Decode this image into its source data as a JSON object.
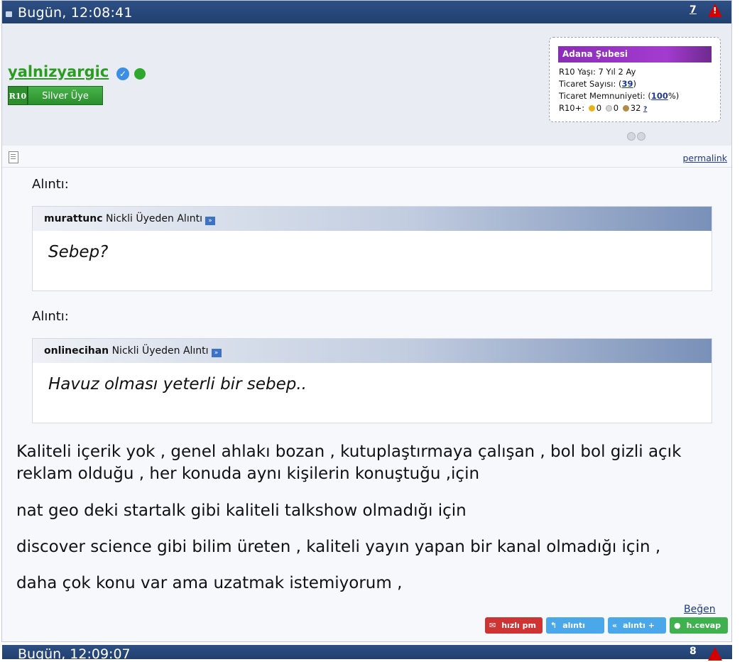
{
  "post": {
    "date": "Bugün, 12:08:41",
    "number": "7",
    "warn_glyph": "!"
  },
  "user": {
    "name": "yalnizyargic",
    "verified_glyph": "✓",
    "rank_code": "R10",
    "rank_title": "Silver Üye",
    "branch": "Adana Şubesi",
    "age_label": "R10 Yaşı: 7 Yıl 2 Ay",
    "trade_count_label": "Ticaret Sayısı: (",
    "trade_count": "39",
    "trade_count_suffix": ")",
    "satisfaction_label": "Ticaret Memnuniyeti: (",
    "satisfaction": "100",
    "satisfaction_suffix": "%)",
    "r10plus_label": "R10+:",
    "gold_count": "0",
    "silver_count": "0",
    "bronze_count": "32",
    "help_mark": "?"
  },
  "permalink_label": "permalink",
  "quotes": [
    {
      "label": "Alıntı:",
      "author": "murattunc",
      "source_text": "Nickli Üyeden Alıntı",
      "body": "Sebep?"
    },
    {
      "label": "Alıntı:",
      "author": "onlinecihan",
      "source_text": "Nickli Üyeden Alıntı",
      "body": "Havuz olması yeterli bir sebep.."
    }
  ],
  "message": [
    "Kaliteli içerik yok , genel ahlakı bozan , kutuplaştırmaya çalışan , bol bol gizli açık reklam olduğu , her konuda aynı kişilerin konuştuğu ,için",
    "nat geo deki startalk gibi kaliteli talkshow olmadığı için",
    "discover science gibi bilim üreten , kaliteli yayın yapan bir kanal olmadığı için ,",
    "daha çok konu var ama uzatmak istemiyorum ,"
  ],
  "actions": {
    "like": "Beğen",
    "quick_pm": "hızlı pm",
    "quote": "alıntı",
    "quote_plus": "alıntı +",
    "quick_reply": "h.cevap"
  },
  "next_post": {
    "date": "Bugün, 12:09:07",
    "number": "8"
  },
  "colors": {
    "header": "#21406f",
    "username": "#2d9b23",
    "branch": "#a43bd0"
  }
}
